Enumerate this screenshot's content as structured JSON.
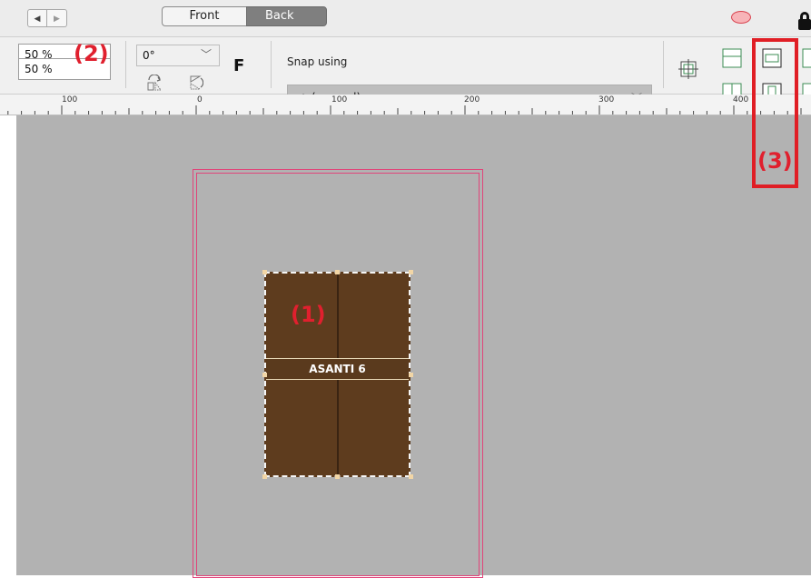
{
  "topbar": {
    "nav_back": "◀",
    "nav_forward": "▶",
    "view_tabs": [
      "Front",
      "Back"
    ],
    "active_tab": "Back"
  },
  "toolbar": {
    "scale_x": "50 %",
    "scale_y": "50 %",
    "rotation": "0°",
    "flag": "F",
    "snap_label": "Snap using",
    "snap_value": "∗  (manual)"
  },
  "ruler": {
    "labels": [
      "100",
      "0",
      "100",
      "200",
      "300",
      "400"
    ]
  },
  "canvas": {
    "product_label": "ASANTI 6"
  },
  "annotations": [
    "(1)",
    "(2)",
    "(3)"
  ],
  "colors": {
    "accent_red": "#e01e25",
    "page_border": "#e0457a",
    "product_fill": "#5e3c1e",
    "canvas_bg": "#b2b2b2"
  }
}
